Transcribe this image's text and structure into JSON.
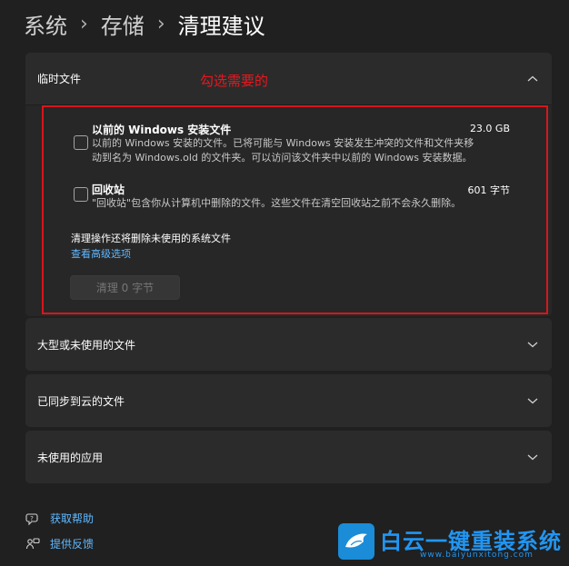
{
  "breadcrumb": {
    "item1": "系统",
    "item2": "存储",
    "current": "清理建议",
    "separator": "›"
  },
  "annotation": {
    "text": "勾选需要的",
    "color": "#e8181e"
  },
  "temp_files": {
    "title": "临时文件",
    "expanded": true,
    "items": [
      {
        "title": "以前的 Windows 安装文件",
        "size": "23.0 GB",
        "checked": false,
        "desc_line1": "以前的 Windows 安装的文件。已将可能与 Windows 安装发生冲突的文件和文件夹移",
        "desc_line2": "动到名为 Windows.old 的文件夹。可以访问该文件夹中以前的 Windows 安装数据。"
      },
      {
        "title": "回收站",
        "size": "601 字节",
        "checked": false,
        "desc_line1": "\"回收站\"包含你从计算机中删除的文件。这些文件在清空回收站之前不会永久删除。"
      }
    ],
    "note": "清理操作还将删除未使用的系统文件",
    "advanced_link": "查看高级选项",
    "clean_button": "清理 0 字节"
  },
  "sections": {
    "large_unused": "大型或未使用的文件",
    "cloud_synced": "已同步到云的文件",
    "unused_apps": "未使用的应用"
  },
  "footer": {
    "help": "获取帮助",
    "feedback": "提供反馈"
  },
  "watermark": {
    "title": "白云一键重装系统",
    "url": "www.baiyunxitong.com"
  },
  "colors": {
    "accent_link": "#60b8ff",
    "card_bg": "#2b2b2b",
    "page_bg": "#202020"
  }
}
